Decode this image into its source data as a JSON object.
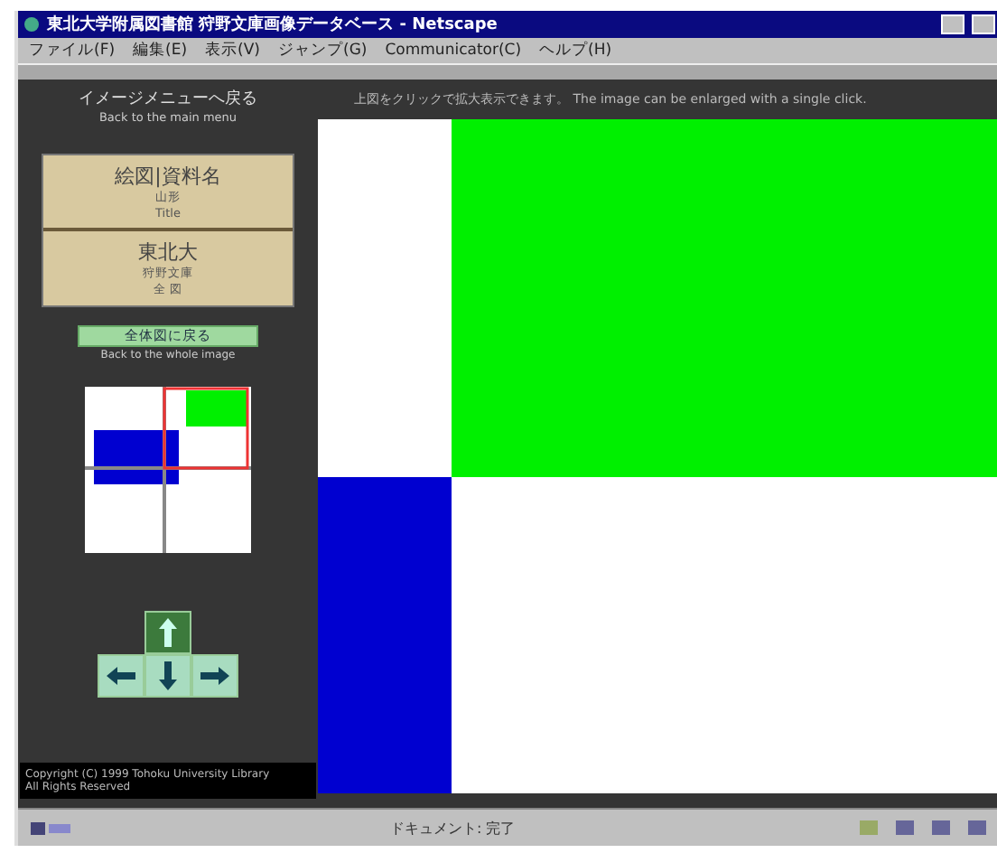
{
  "window": {
    "title": "東北大学附属図書館 狩野文庫画像データベース - Netscape"
  },
  "menu": [
    "ファイル(F)",
    "編集(E)",
    "表示(V)",
    "ジャンプ(G)",
    "Communicator(C)",
    "ヘルプ(H)"
  ],
  "sidebar": {
    "back_link": {
      "label": "イメージメニューへ戻る",
      "sublabel": "Back to the main menu"
    },
    "card": [
      {
        "title": "絵図|資料名",
        "lines": [
          "山形",
          "Title"
        ]
      },
      {
        "title": "東北大",
        "lines": [
          "狩野文庫",
          "全 図"
        ]
      }
    ],
    "whole_button": {
      "label": "全体図に戻る",
      "caption": "Back to the whole image"
    },
    "nav": [
      {
        "kind": "up",
        "active": true
      },
      {
        "kind": "left",
        "active": false
      },
      {
        "kind": "down",
        "active": false
      },
      {
        "kind": "right",
        "active": false
      }
    ],
    "copyright": [
      "Copyright (C) 1999 Tohoku University Library",
      "All Rights Reserved"
    ]
  },
  "main": {
    "hint": "上図をクリックで拡大表示できます。 The image can be enlarged with a single click."
  },
  "status_bar": {
    "text": "ドキュメント: 完了"
  }
}
